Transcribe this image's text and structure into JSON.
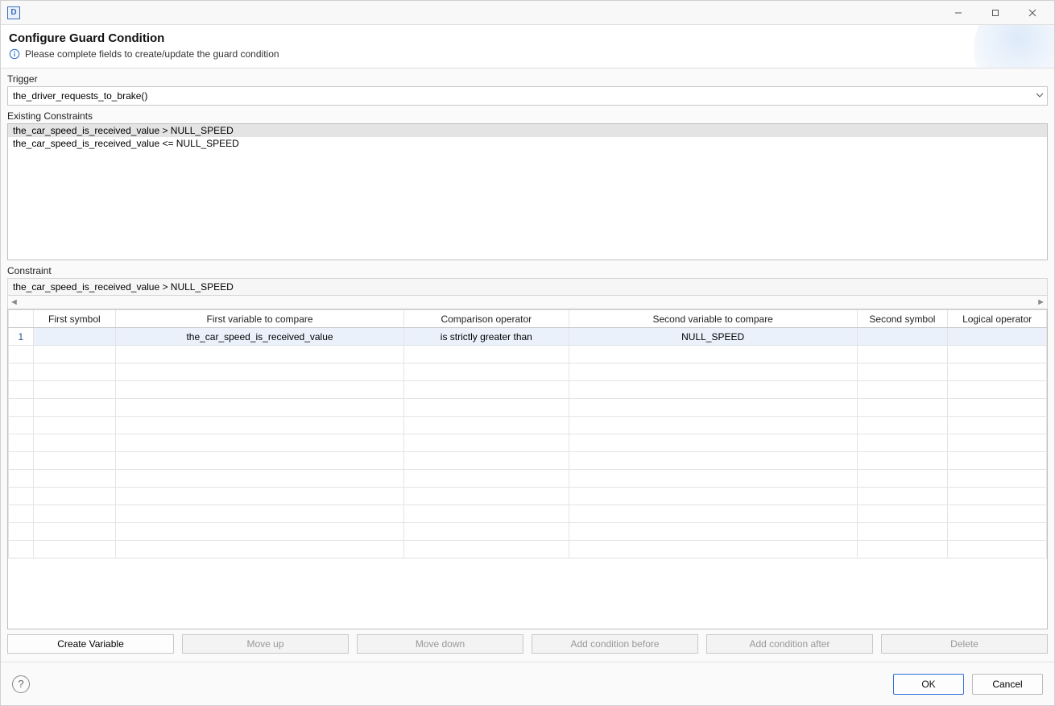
{
  "window": {
    "app_icon_letter": "D"
  },
  "header": {
    "title": "Configure Guard Condition",
    "subtitle": "Please complete fields to create/update the guard condition"
  },
  "trigger": {
    "label": "Trigger",
    "value": "the_driver_requests_to_brake()"
  },
  "existing": {
    "label": "Existing Constraints",
    "items": [
      "the_car_speed_is_received_value > NULL_SPEED",
      "the_car_speed_is_received_value <= NULL_SPEED"
    ]
  },
  "constraint": {
    "label": "Constraint",
    "readout": "the_car_speed_is_received_value > NULL_SPEED",
    "columns": {
      "first_symbol": "First symbol",
      "first_variable": "First variable to compare",
      "comparison_operator": "Comparison operator",
      "second_variable": "Second variable to compare",
      "second_symbol": "Second symbol",
      "logical_operator": "Logical operator"
    },
    "rows": [
      {
        "num": "1",
        "first_symbol": "",
        "first_variable": "the_car_speed_is_received_value",
        "comparison_operator": "is strictly greater than",
        "second_variable": "NULL_SPEED",
        "second_symbol": "",
        "logical_operator": ""
      }
    ]
  },
  "toolbar": {
    "create_variable": "Create Variable",
    "move_up": "Move up",
    "move_down": "Move down",
    "add_before": "Add condition before",
    "add_after": "Add condition after",
    "delete": "Delete"
  },
  "footer": {
    "ok": "OK",
    "cancel": "Cancel"
  }
}
